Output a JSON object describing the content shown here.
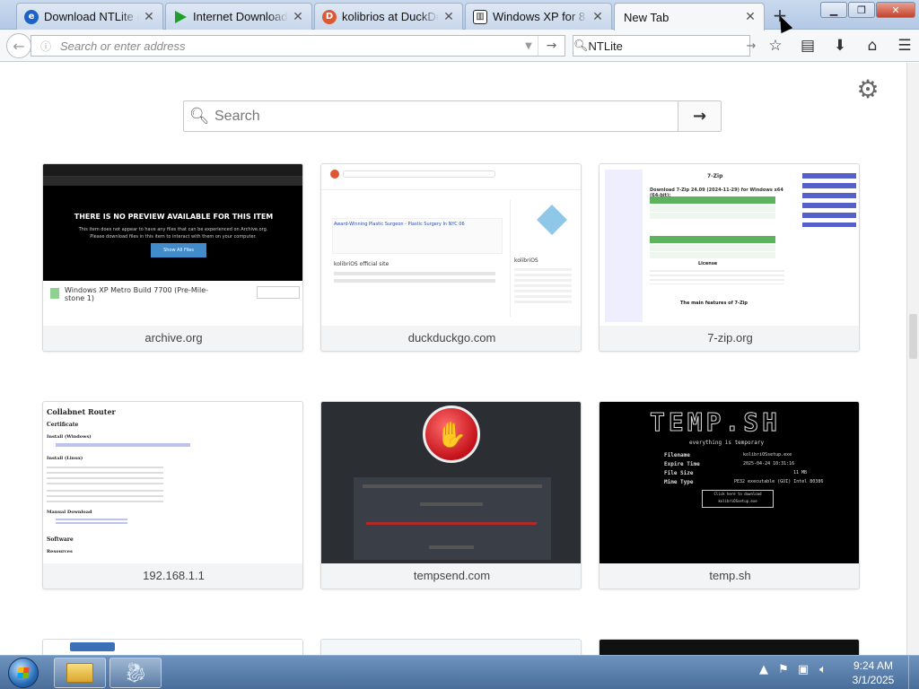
{
  "tabs": [
    {
      "label": "Download NTLite (3",
      "icon": "edge-e-icon",
      "color": "#1c63c7"
    },
    {
      "label": "Internet Download",
      "icon": "idm-arrow-icon",
      "color": "#1f9e2a"
    },
    {
      "label": "kolibrios at DuckDu",
      "icon": "duckduckgo-icon",
      "color": "#de5833"
    },
    {
      "label": "Windows XP for 8.x",
      "icon": "archive-icon",
      "color": "#222222"
    },
    {
      "label": "New Tab",
      "icon": "none"
    }
  ],
  "toolbar": {
    "url_placeholder": "Search or enter address",
    "search_value": "NTLite"
  },
  "page": {
    "search_placeholder": "Search"
  },
  "tiles": [
    {
      "label": "archive.org"
    },
    {
      "label": "duckduckgo.com"
    },
    {
      "label": "7-zip.org"
    },
    {
      "label": "192.168.1.1"
    },
    {
      "label": "tempsend.com"
    },
    {
      "label": "temp.sh"
    }
  ],
  "thumbs": {
    "archive": {
      "headline": "THERE IS NO PREVIEW AVAILABLE FOR THIS ITEM",
      "line1": "This item does not appear to have any files that can be experienced on Archive.org.",
      "line2": "Please download files in this item to interact with them on your computer.",
      "button": "Show All Files",
      "item_title": "Windows XP Metro Build 7700 (Pre-Mile-stone 1)"
    },
    "duck": {
      "result_title": "Award-Winning Plastic Surgeon - Plastic Surgery In NYC 06",
      "side_title": "kolibriOS",
      "section": "kolibriOS official site"
    },
    "sevenzip": {
      "title": "7-Zip",
      "heading": "Download 7-Zip 24.09 (2024-11-29) for Windows x64 (64-bit):",
      "license": "License",
      "features": "The main features of 7-Zip"
    },
    "router": {
      "title": "Collabnet Router",
      "certificate": "Certificate",
      "install_win": "Install (Windows)",
      "install_linux": "Install (Linux)",
      "manual": "Manual Download",
      "software": "Software",
      "resources": "Resources"
    },
    "temp": {
      "logo": "TEMP.SH",
      "tagline": "everything is temporary",
      "filename_k": "Filename",
      "filename_v": "kolibriOSsetup.exe",
      "expire_k": "Expire Time",
      "expire_v": "2025-04-24 10:31:16",
      "size_k": "File Size",
      "size_v": "11 MB",
      "mime_k": "Mime Type",
      "mime_v": "PE32 executable (GUI) Intel 80386",
      "btn1": "Click here to download",
      "btn2": "kolibriOSsetup.exe"
    }
  },
  "taskbar": {
    "time": "9:24 AM",
    "date": "3/1/2025"
  },
  "colors": {
    "accent": "#4a6d9a",
    "ddg": "#de5833",
    "sevenzip_green": "#1f9e2a"
  }
}
